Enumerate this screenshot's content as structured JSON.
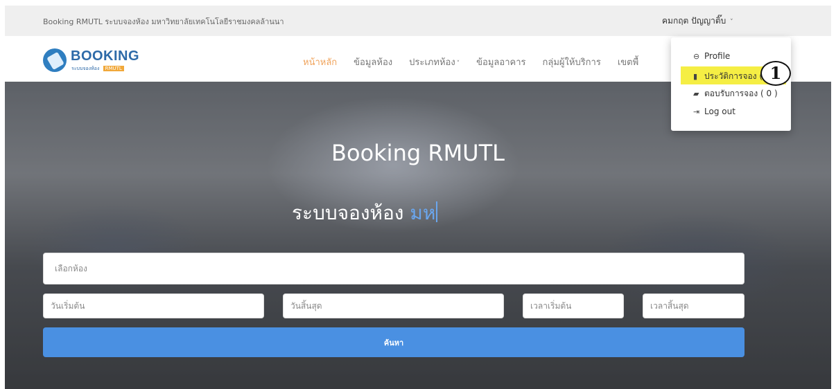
{
  "topbar": {
    "site_title": "Booking RMUTL ระบบจองห้อง มหาวิทยาลัยเทคโนโลยีราชมงคลล้านนา",
    "user_name": "คมกฤต ปัญญาติ๊บ",
    "user_chevron": "˅"
  },
  "logo": {
    "brand": "BOOKING",
    "subtitle": "ระบบจองห้อง",
    "subtitle_highlight": "RMUTL",
    "icon": "booking-tag-icon"
  },
  "nav": {
    "items": [
      {
        "label": "หน้าหลัก",
        "active": true
      },
      {
        "label": "ข้อมูลห้อง"
      },
      {
        "label": "ประเภทห้อง",
        "has_caret": true
      },
      {
        "label": "ข้อมูลอาคาร"
      },
      {
        "label": "กลุ่มผู้ให้บริการ"
      },
      {
        "label": "เขตพื้"
      }
    ],
    "caret": "˅"
  },
  "hero": {
    "heading": "Booking RMUTL",
    "tagline_prefix": "ระบบจองห้อง",
    "tagline_typed": "มห"
  },
  "search": {
    "room_placeholder": "เลือกห้อง",
    "start_date_placeholder": "วันเริ่มต้น",
    "end_date_placeholder": "วันสิ้นสุด",
    "start_time_placeholder": "เวลาเริ่มต้น",
    "end_time_placeholder": "เวลาสิ้นสุด",
    "button_label": "ค้นหา"
  },
  "user_dropdown": {
    "profile": {
      "label": "Profile",
      "icon": "user-circle-icon",
      "glyph": "⊖"
    },
    "history": {
      "label": "ประวัติการจอง (",
      "icon": "bookmark-icon",
      "glyph": "▮"
    },
    "reply": {
      "label": "ตอบรับการจอง ( 0 )",
      "icon": "book-icon",
      "glyph": "▰"
    },
    "logout": {
      "label": "Log out",
      "icon": "sign-out-icon",
      "glyph": "⇥"
    }
  },
  "annotation": {
    "step_number": "1"
  },
  "colors": {
    "accent_orange": "#f0a35b",
    "button_blue": "#4a90e2",
    "highlight_yellow": "#f5ee44",
    "brand_blue": "#2d6aa8"
  }
}
